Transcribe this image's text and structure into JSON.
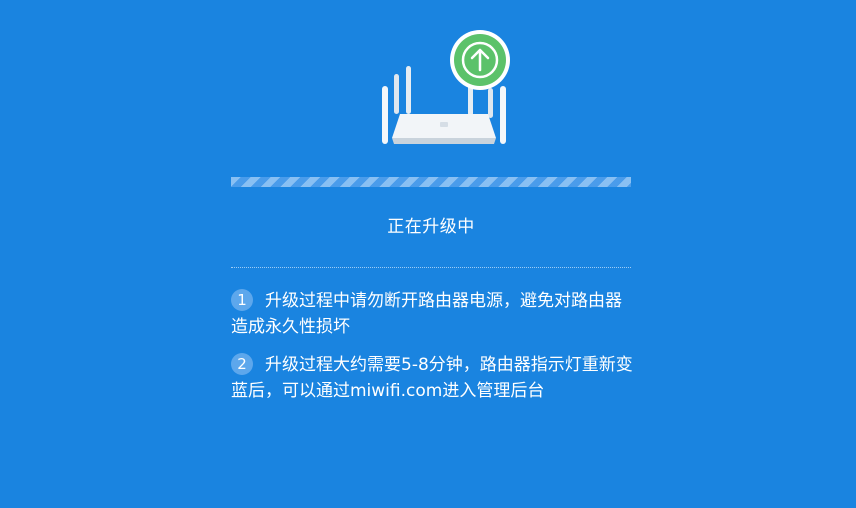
{
  "status": {
    "upgrading_text": "正在升级中"
  },
  "notices": [
    {
      "number": "1",
      "text": "升级过程中请勿断开路由器电源，避免对路由器造成永久性损坏"
    },
    {
      "number": "2",
      "text": "升级过程大约需要5-8分钟，路由器指示灯重新变蓝后，可以通过miwifi.com进入管理后台"
    }
  ],
  "colors": {
    "background": "#1a84e0",
    "upload_badge": "#5cc26a",
    "progress_light": "#89c0f3",
    "progress_dark": "#4a9ceb",
    "number_badge": "#5da7ec"
  },
  "icons": {
    "illustration": "router-icon",
    "badge": "upload-arrow-icon"
  }
}
